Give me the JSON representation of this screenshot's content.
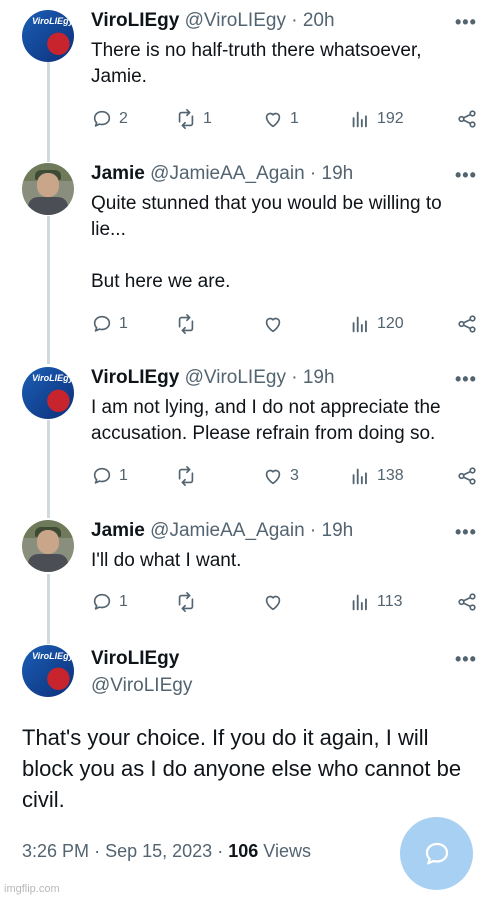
{
  "tweets": [
    {
      "name": "ViroLIEgy",
      "handle": "@ViroLIEgy",
      "time": "20h",
      "text": "There is no half-truth there whatsoever,\nJamie.",
      "replies": "2",
      "retweets": "1",
      "likes": "1",
      "views": "192",
      "avatar": "virus-avatar"
    },
    {
      "name": "Jamie",
      "handle": "@JamieAA_Again",
      "time": "19h",
      "text": "Quite stunned that you would be willing to\nlie...\n\nBut here we are.",
      "replies": "1",
      "retweets": "",
      "likes": "",
      "views": "120",
      "avatar": "person-avatar"
    },
    {
      "name": "ViroLIEgy",
      "handle": "@ViroLIEgy",
      "time": "19h",
      "text": "I am not lying, and I do not appreciate the\naccusation. Please refrain from doing so.",
      "replies": "1",
      "retweets": "",
      "likes": "3",
      "views": "138",
      "avatar": "virus-avatar"
    },
    {
      "name": "Jamie",
      "handle": "@JamieAA_Again",
      "time": "19h",
      "text": "I'll do what I want.",
      "replies": "1",
      "retweets": "",
      "likes": "",
      "views": "113",
      "avatar": "person-avatar"
    }
  ],
  "main_tweet": {
    "name": "ViroLIEgy",
    "handle": "@ViroLIEgy",
    "text": "That's your choice. If you do it again, I will\nblock you as I do anyone else who cannot be\ncivil.",
    "time": "3:26 PM",
    "date": "Sep 15, 2023",
    "views_count": "106",
    "views_label": "Views"
  },
  "avatar_badge": "ViroLIEgy",
  "separator": "·",
  "watermark": "imgflip.com",
  "colors": {
    "text": "#0f1419",
    "muted": "#536471",
    "thread": "#cfd9de",
    "fab": "#a8d0f3"
  }
}
